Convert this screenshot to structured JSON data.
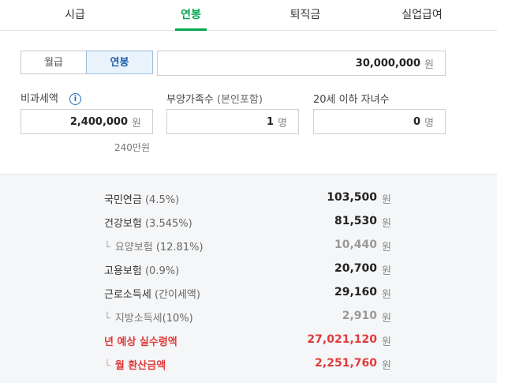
{
  "tabs": [
    {
      "label": "시급"
    },
    {
      "label": "연봉"
    },
    {
      "label": "퇴직금"
    },
    {
      "label": "실업급여"
    }
  ],
  "active_tab": "연봉",
  "accent_color": "#03a94f",
  "period_toggle": {
    "monthly": "월급",
    "annual": "연봉",
    "selected": "연봉"
  },
  "salary": {
    "value": "30,000,000",
    "unit": "원"
  },
  "nontax": {
    "label": "비과세액",
    "info_icon": "info-icon",
    "value": "2,400,000",
    "unit": "원",
    "hint": "240만원"
  },
  "dependents": {
    "label": "부양가족수",
    "label_sub": "(본인포함)",
    "value": "1",
    "unit": "명"
  },
  "children": {
    "label": "20세 이하 자녀수",
    "value": "0",
    "unit": "명"
  },
  "results": {
    "won": "원",
    "rows": [
      {
        "name": "국민연금",
        "pct": "(4.5%)",
        "amount": "103,500"
      },
      {
        "name": "건강보험",
        "pct": "(3.545%)",
        "amount": "81,530"
      },
      {
        "name": "요양보험",
        "pct": "(12.81%)",
        "amount": "10,440"
      },
      {
        "name": "고용보험",
        "pct": "(0.9%)",
        "amount": "20,700"
      },
      {
        "name": "근로소득세",
        "pct": "(간이세액)",
        "amount": "29,160"
      },
      {
        "name": "지방소득세",
        "pct": "(10%)",
        "amount": "2,910"
      },
      {
        "name": "년 예상 실수령액",
        "pct": "",
        "amount": "27,021,120"
      },
      {
        "name": "월 환산금액",
        "pct": "",
        "amount": "2,251,760"
      }
    ]
  }
}
